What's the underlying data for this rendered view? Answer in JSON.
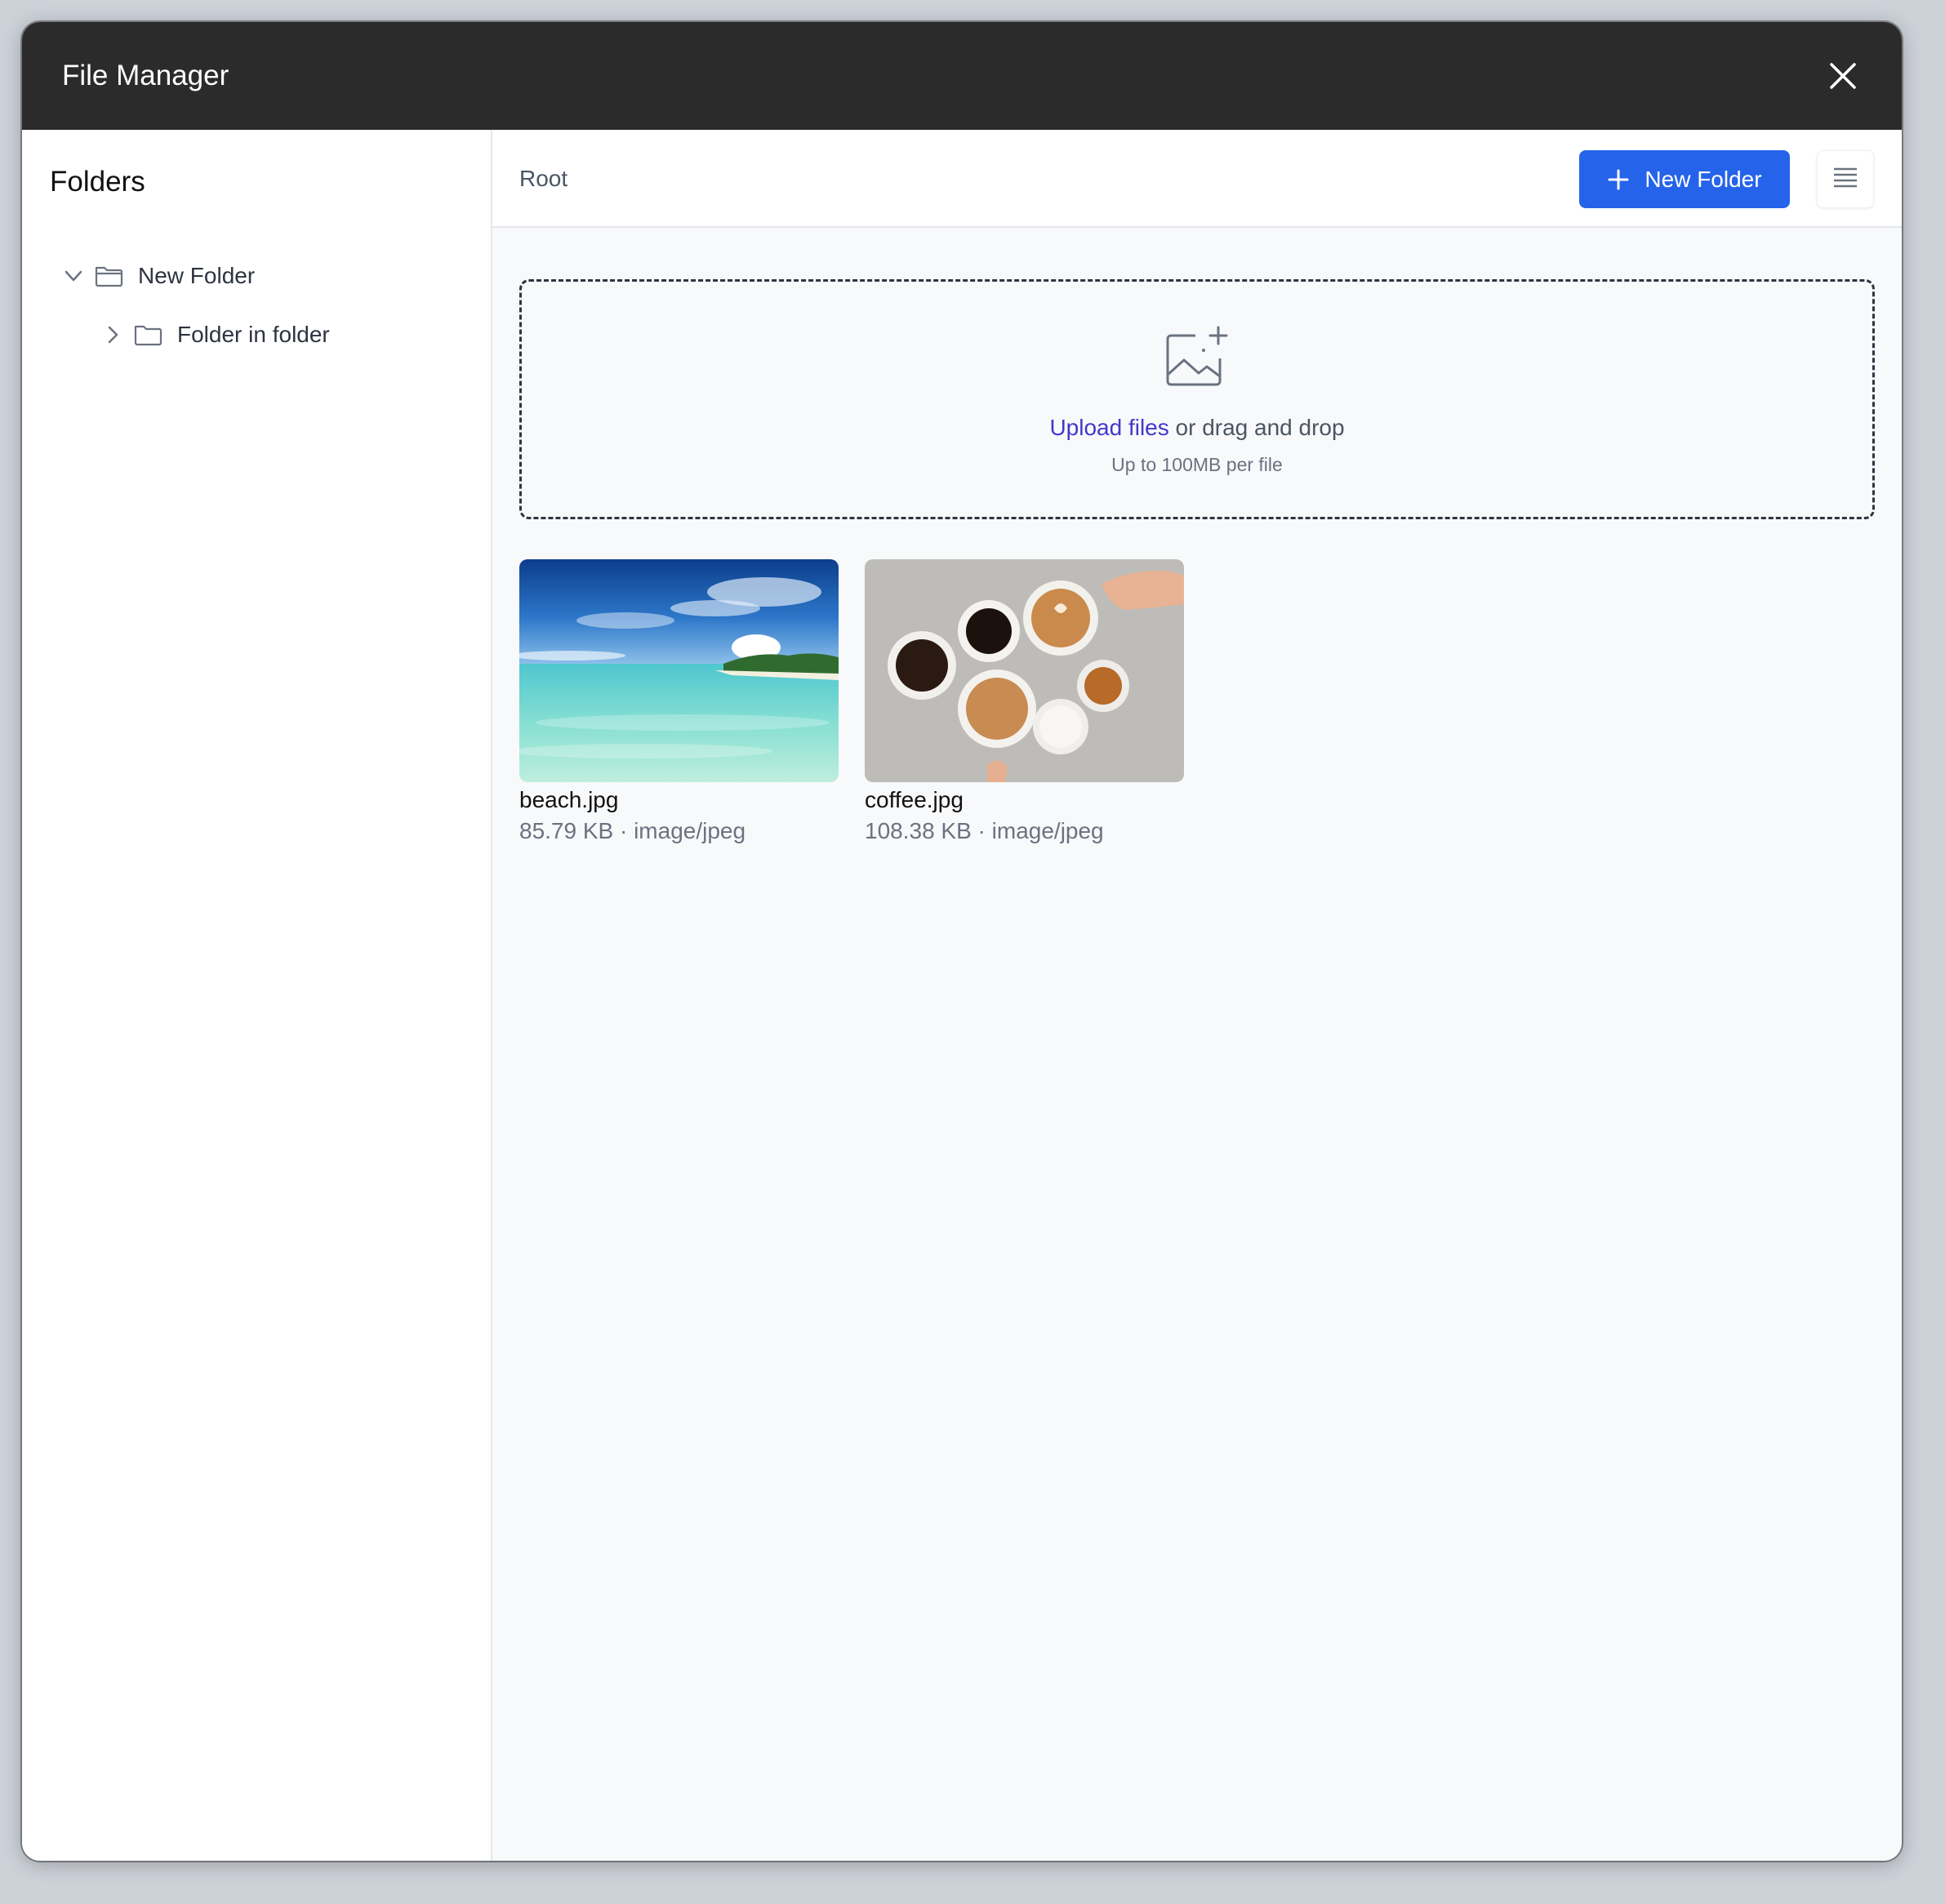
{
  "window": {
    "title": "File Manager",
    "close_icon": "close-icon"
  },
  "sidebar": {
    "heading": "Folders",
    "items": [
      {
        "label": "New Folder",
        "expanded": true,
        "icon": "folder-icon"
      },
      {
        "label": "Folder in folder",
        "expanded": false,
        "icon": "folder-icon"
      }
    ]
  },
  "toolbar": {
    "breadcrumb": "Root",
    "new_folder_label": "New Folder",
    "view_icon": "list-view-icon"
  },
  "dropzone": {
    "link_text": "Upload files",
    "rest_text": " or drag and drop",
    "hint": "Up to 100MB per file",
    "icon": "image-add-icon"
  },
  "files": [
    {
      "name": "beach.jpg",
      "meta": "85.79 KB · image/jpeg"
    },
    {
      "name": "coffee.jpg",
      "meta": "108.38 KB · image/jpeg"
    }
  ],
  "colors": {
    "titlebar": "#2b2b2b",
    "accent": "#2563eb",
    "link": "#4338ca"
  }
}
